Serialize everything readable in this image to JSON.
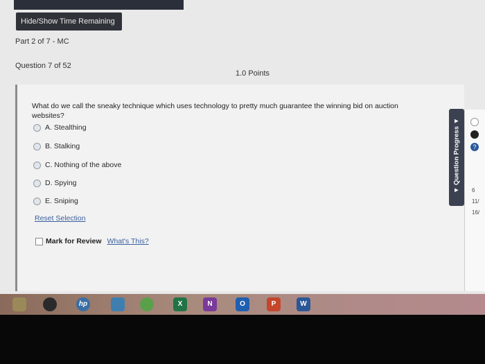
{
  "header": {
    "hide_show_label": "Hide/Show Time Remaining",
    "part_label": "Part 2 of 7 - MC",
    "question_label": "Question 7 of 52",
    "points": "1.0 Points"
  },
  "question": {
    "text": "What do we call the sneaky technique which uses technology to pretty much guarantee the winning bid on auction websites?",
    "options": [
      {
        "label": "A. Stealthing"
      },
      {
        "label": "B. Stalking"
      },
      {
        "label": "C. Nothing of the above"
      },
      {
        "label": "D. Spying"
      },
      {
        "label": "E. Sniping"
      }
    ],
    "reset_label": "Reset Selection",
    "mark_review_label": "Mark for Review",
    "whats_this_label": "What's This?"
  },
  "side_panel": {
    "tab_label": "▼ Question Progress ▼",
    "items": [
      "6",
      "11/",
      "16/"
    ]
  },
  "taskbar": {
    "apps": [
      {
        "icon": "folder-icon",
        "glyph": "",
        "color": "#9a8a5a"
      },
      {
        "icon": "chrome-icon",
        "glyph": "",
        "color": "#2a2a2a"
      },
      {
        "icon": "hp-icon",
        "glyph": "hp",
        "color": "#3a6ea5"
      },
      {
        "icon": "screen-icon",
        "glyph": "",
        "color": "#3f7fb0"
      },
      {
        "icon": "chrome-icon",
        "glyph": "",
        "color": "#5aa04a"
      },
      {
        "icon": "excel-icon",
        "glyph": "X",
        "color": "#217346"
      },
      {
        "icon": "onenote-icon",
        "glyph": "N",
        "color": "#7a3a9a"
      },
      {
        "icon": "outlook-icon",
        "glyph": "O",
        "color": "#1f5fb0"
      },
      {
        "icon": "powerpoint-icon",
        "glyph": "P",
        "color": "#c4462b"
      },
      {
        "icon": "word-icon",
        "glyph": "W",
        "color": "#2b5797"
      }
    ]
  }
}
